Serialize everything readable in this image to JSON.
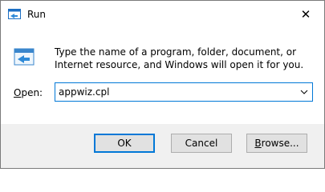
{
  "window": {
    "title": "Run",
    "close_symbol": "✕",
    "title_icon": "run-icon",
    "accent_color": "#0078d7"
  },
  "dialog": {
    "description": "Type the name of a program, folder, document, or Internet resource, and Windows will open it for you.",
    "open_label_accel": "O",
    "open_label_rest": "pen:",
    "input_value": "appwiz.cpl"
  },
  "buttons": {
    "ok": "OK",
    "cancel": "Cancel",
    "browse_accel": "B",
    "browse_rest": "rowse..."
  }
}
